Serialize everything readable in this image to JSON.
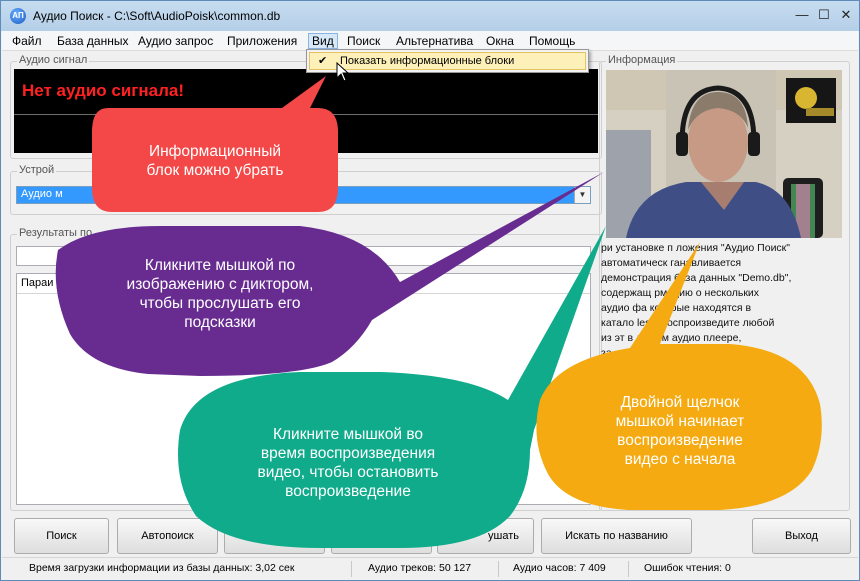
{
  "window": {
    "title": "Аудио Поиск - C:\\Soft\\AudioPoisk\\common.db",
    "app_icon_text": "АП",
    "minimize": "—",
    "maximize": "☐",
    "close": "✕"
  },
  "menu": {
    "items": [
      "Файл",
      "База данных",
      "Аудио запрос",
      "Приложения",
      "Вид",
      "Поиск",
      "Альтернатива",
      "Окна",
      "Помощь"
    ],
    "active": "Вид",
    "dropdown_item": "Показать информационные блоки",
    "dropdown_checked": true
  },
  "audio_signal": {
    "label": "Аудио сигнал",
    "message": "Нет аудио сигнала!"
  },
  "device": {
    "label": "Устрой",
    "value": "Аудио м"
  },
  "results": {
    "label": "Результаты по",
    "param_header": "Параи"
  },
  "info": {
    "label": "Информация",
    "lines": [
      "ри установке п    ложения \"Аудио Поиск\"",
      "автоматическ     ганавливается",
      "демонстрация     база данных \"Demo.db\",",
      "содержащ     рмацию о нескольких",
      "аудио фа     которые находятся в",
      "катало     les\". Воспроизведите любой",
      "из эт       в любом аудио плеере,",
      "",
      "",
      "",
      "",
      "",
      "",
      "                                                     за"
    ]
  },
  "buttons": {
    "search": "Поиск",
    "autosearch": "Автопоиск",
    "listen": "ушать",
    "search_by_name": "Искать по названию",
    "exit": "Выход"
  },
  "status": {
    "load_time": "Время загрузки информации из базы данных: 3,02 сек",
    "tracks": "Аудио треков: 50 127",
    "hours": "Аудио часов: 7 409",
    "errors": "Ошибок чтения: 0"
  },
  "callouts": {
    "red": [
      "Информационный",
      "блок можно убрать"
    ],
    "purple": [
      "Кликните мышкой по",
      "изображению с диктором,",
      "чтобы прослушать его",
      "подсказки"
    ],
    "green": [
      "Кликните мышкой во",
      "время воспроизведения",
      "видео, чтобы остановить",
      "воспроизведение"
    ],
    "orange": [
      "Двойной щелчок",
      "мышкой начинает",
      "воспроизведение",
      "видео с начала"
    ]
  },
  "colors": {
    "red_callout": "#f44848",
    "purple_callout": "#682c91",
    "green_callout": "#10ab8b",
    "orange_callout": "#f4aa10",
    "signal_text": "#ff2121",
    "selection": "#3399ff"
  }
}
